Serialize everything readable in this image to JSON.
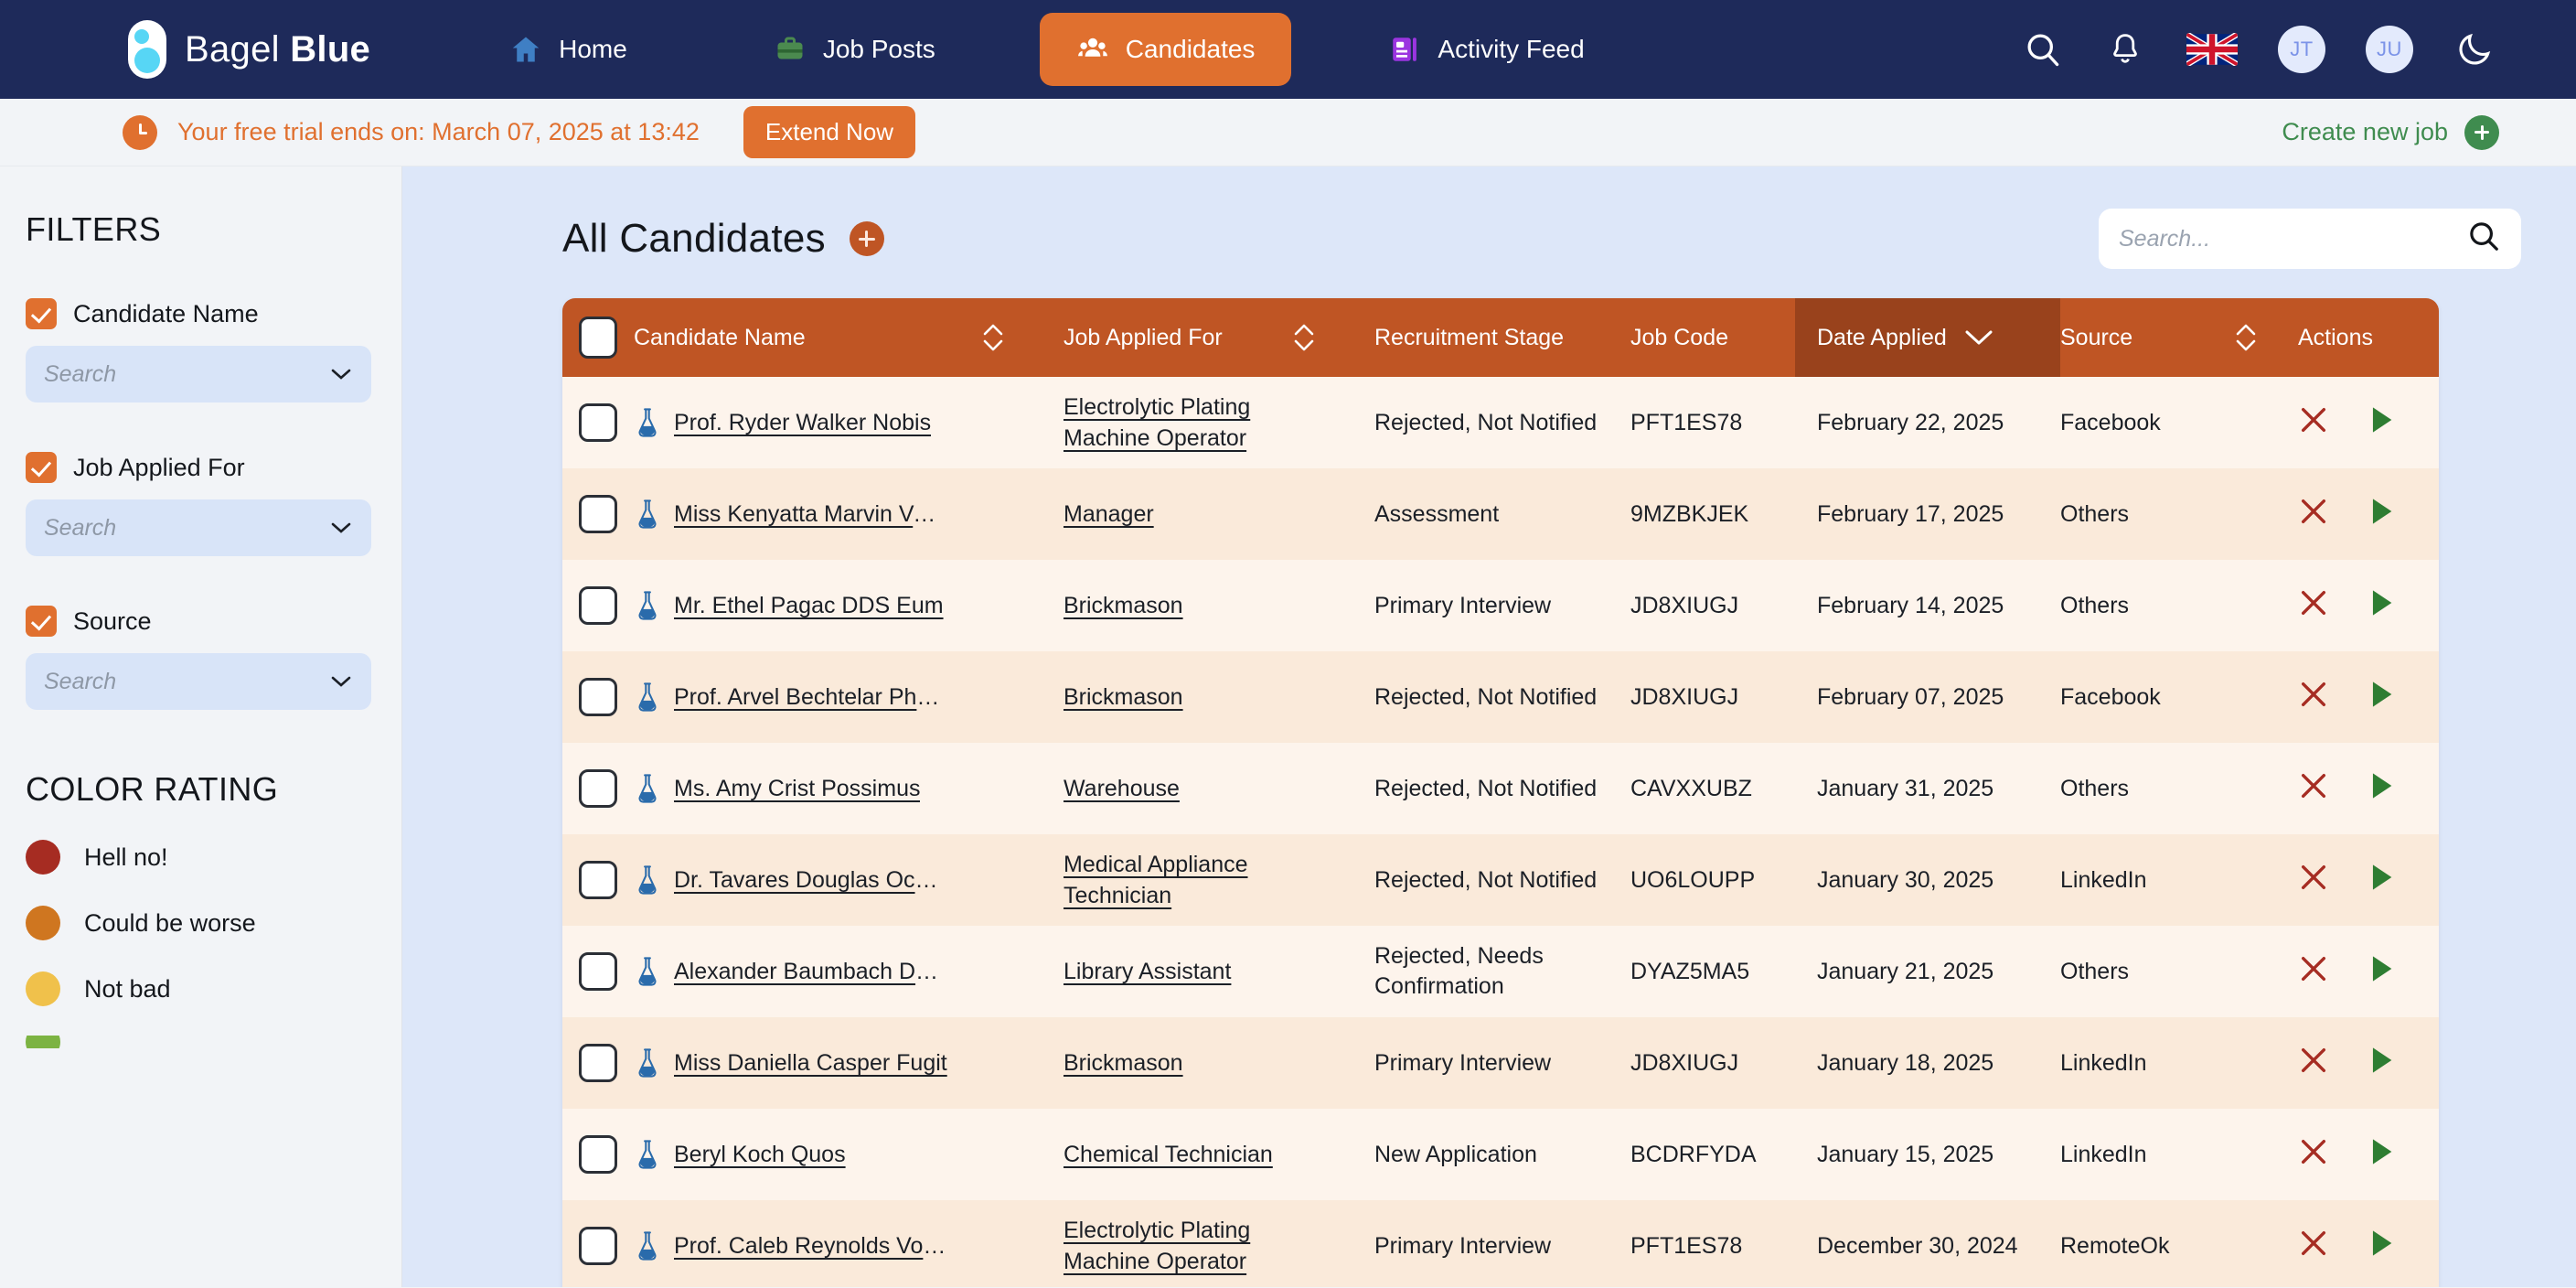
{
  "brand": {
    "name_light": "Bagel ",
    "name_bold": "Blue"
  },
  "nav": {
    "items": [
      {
        "label": "Home",
        "icon": "home-icon",
        "active": false
      },
      {
        "label": "Job Posts",
        "icon": "briefcase-icon",
        "active": false
      },
      {
        "label": "Candidates",
        "icon": "people-icon",
        "active": true
      },
      {
        "label": "Activity Feed",
        "icon": "activity-feed-icon",
        "active": false
      }
    ],
    "right": {
      "search_icon": "search-icon",
      "bell_icon": "notification-bell-icon",
      "flag_icon": "uk-flag-icon",
      "avatar_1": "JT",
      "avatar_2": "JU",
      "theme_icon": "moon-dark-mode-icon"
    }
  },
  "trial": {
    "clock_icon": "clock-icon",
    "message": "Your free trial ends on: March 07, 2025 at 13:42",
    "extend_label": "Extend Now",
    "create_job_label": "Create new job",
    "create_job_icon": "plus-circle-icon"
  },
  "sidebar": {
    "filters_title": "FILTERS",
    "filters": [
      {
        "label": "Candidate Name",
        "checked": true,
        "placeholder": "Search"
      },
      {
        "label": "Job Applied For",
        "checked": true,
        "placeholder": "Search"
      },
      {
        "label": "Source",
        "checked": true,
        "placeholder": "Search"
      }
    ],
    "color_rating_title": "COLOR RATING",
    "ratings": [
      {
        "label": "Hell no!",
        "color": "#a62c22"
      },
      {
        "label": "Could be worse",
        "color": "#cf7620"
      },
      {
        "label": "Not bad",
        "color": "#f0c14b"
      },
      {
        "label": "",
        "color": "#7cb342"
      }
    ]
  },
  "main": {
    "title": "All Candidates",
    "add_icon": "plus-circle-icon",
    "search_placeholder": "Search...",
    "search_icon": "search-icon"
  },
  "table": {
    "columns": [
      {
        "key": "candidate_name",
        "label": "Candidate Name",
        "sortable": true,
        "sort_state": "none"
      },
      {
        "key": "job_applied_for",
        "label": "Job Applied For",
        "sortable": true,
        "sort_state": "none"
      },
      {
        "key": "recruitment_stage",
        "label": "Recruitment Stage",
        "sortable": false
      },
      {
        "key": "job_code",
        "label": "Job Code",
        "sortable": false
      },
      {
        "key": "date_applied",
        "label": "Date Applied",
        "sortable": true,
        "sort_state": "desc"
      },
      {
        "key": "source",
        "label": "Source",
        "sortable": true,
        "sort_state": "none"
      },
      {
        "key": "actions",
        "label": "Actions",
        "sortable": false
      }
    ],
    "select_all_checked": false,
    "rows": [
      {
        "checked": false,
        "name": "Prof. Ryder Walker Nobis",
        "job": "Electrolytic Plating Machine Operator",
        "stage": "Rejected, Not Notified",
        "code": "PFT1ES78",
        "date": "February 22, 2025",
        "source": "Facebook"
      },
      {
        "checked": false,
        "name": "Miss Kenyatta Marvin Volupt…",
        "job": "Manager",
        "stage": "Assessment",
        "code": "9MZBKJEK",
        "date": "February 17, 2025",
        "source": "Others"
      },
      {
        "checked": false,
        "name": "Mr. Ethel Pagac DDS Eum",
        "job": "Brickmason",
        "stage": "Primary Interview",
        "code": "JD8XIUGJ",
        "date": "February 14, 2025",
        "source": "Others"
      },
      {
        "checked": false,
        "name": "Prof. Arvel Bechtelar PhD La…",
        "job": "Brickmason",
        "stage": "Rejected, Not Notified",
        "code": "JD8XIUGJ",
        "date": "February 07, 2025",
        "source": "Facebook"
      },
      {
        "checked": false,
        "name": "Ms. Amy Crist Possimus",
        "job": "Warehouse",
        "stage": "Rejected, Not Notified",
        "code": "CAVXXUBZ",
        "date": "January 31, 2025",
        "source": "Others"
      },
      {
        "checked": false,
        "name": "Dr. Tavares Douglas Occaecati",
        "job": "Medical Appliance Technician",
        "stage": "Rejected, Not Notified",
        "code": "UO6LOUPP",
        "date": "January 30, 2025",
        "source": "LinkedIn"
      },
      {
        "checked": false,
        "name": "Alexander Baumbach Dolore…",
        "job": "Library Assistant",
        "stage": "Rejected, Needs Confirmation",
        "code": "DYAZ5MA5",
        "date": "January 21, 2025",
        "source": "Others"
      },
      {
        "checked": false,
        "name": "Miss Daniella Casper Fugit",
        "job": "Brickmason",
        "stage": "Primary Interview",
        "code": "JD8XIUGJ",
        "date": "January 18, 2025",
        "source": "LinkedIn"
      },
      {
        "checked": false,
        "name": "Beryl Koch Quos",
        "job": "Chemical Technician",
        "stage": "New Application",
        "code": "BCDRFYDA",
        "date": "January 15, 2025",
        "source": "LinkedIn"
      },
      {
        "checked": false,
        "name": "Prof. Caleb Reynolds Volupta…",
        "job": "Electrolytic Plating Machine Operator",
        "stage": "Primary Interview",
        "code": "PFT1ES78",
        "date": "December 30, 2024",
        "source": "RemoteOk"
      }
    ],
    "row_actions": {
      "reject_icon": "reject-x-icon",
      "advance_icon": "advance-play-icon"
    }
  },
  "colors": {
    "nav_bg": "#1e2a5a",
    "accent_orange": "#e0702f",
    "table_header": "#bf5524",
    "table_header_sorted": "#99421c",
    "main_bg": "#dde7f9",
    "row_even": "#fdf4ec",
    "row_odd": "#faeada",
    "green": "#3f8c4f",
    "reject_red": "#a62c22"
  }
}
